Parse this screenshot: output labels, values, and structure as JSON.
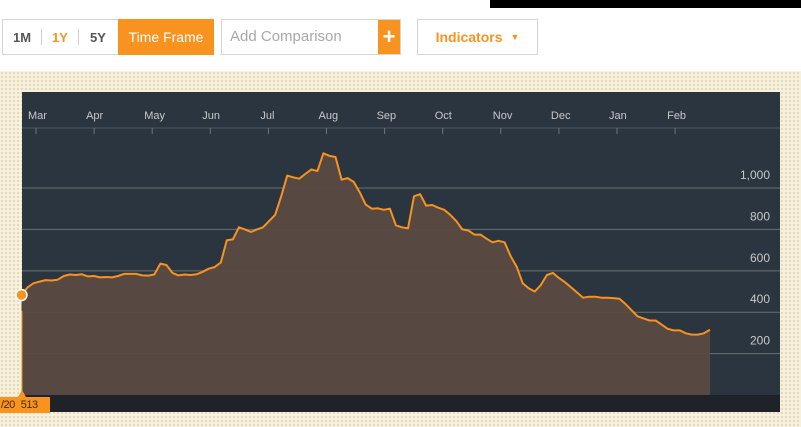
{
  "toolbar": {
    "ranges": [
      "1M",
      "1Y",
      "5Y"
    ],
    "active_range": "1Y",
    "time_frame_label": "Time Frame",
    "compare_placeholder": "Add Comparison",
    "add_label": "+",
    "indicators_label": "Indicators"
  },
  "tooltip": {
    "date": "/20",
    "value": "513"
  },
  "colors": {
    "accent": "#f7931e",
    "plot_bg": "#2b3540",
    "area_fill": "#5a4a41",
    "panel_bg": "#f6f0dc"
  },
  "chart_data": {
    "type": "area",
    "months": [
      "Mar",
      "Apr",
      "May",
      "Jun",
      "Jul",
      "Aug",
      "Sep",
      "Oct",
      "Nov",
      "Dec",
      "Jan",
      "Feb"
    ],
    "y_ticks": [
      "1,000",
      "800",
      "600",
      "400",
      "200"
    ],
    "y_tick_values": [
      1000,
      800,
      600,
      400,
      200
    ],
    "ylim": [
      0,
      1290
    ],
    "grid": true,
    "x_start_month_index": -0.25,
    "x_end_month_index": 11.6,
    "values": [
      483,
      520,
      540,
      548,
      555,
      553,
      557,
      575,
      582,
      580,
      583,
      573,
      575,
      568,
      570,
      568,
      575,
      585,
      585,
      585,
      578,
      577,
      582,
      635,
      628,
      590,
      578,
      582,
      580,
      583,
      595,
      610,
      618,
      640,
      748,
      752,
      810,
      800,
      788,
      800,
      810,
      840,
      870,
      960,
      1060,
      1052,
      1045,
      1068,
      1090,
      1082,
      1168,
      1155,
      1150,
      1040,
      1048,
      1030,
      980,
      920,
      900,
      902,
      895,
      900,
      820,
      810,
      805,
      960,
      970,
      915,
      918,
      905,
      895,
      870,
      840,
      800,
      795,
      775,
      775,
      755,
      738,
      745,
      738,
      670,
      620,
      540,
      515,
      500,
      532,
      580,
      590,
      565,
      545,
      520,
      495,
      470,
      475,
      475,
      470,
      470,
      468,
      465,
      440,
      410,
      380,
      370,
      360,
      360,
      340,
      320,
      312,
      312,
      298,
      292,
      292,
      298,
      315
    ]
  }
}
